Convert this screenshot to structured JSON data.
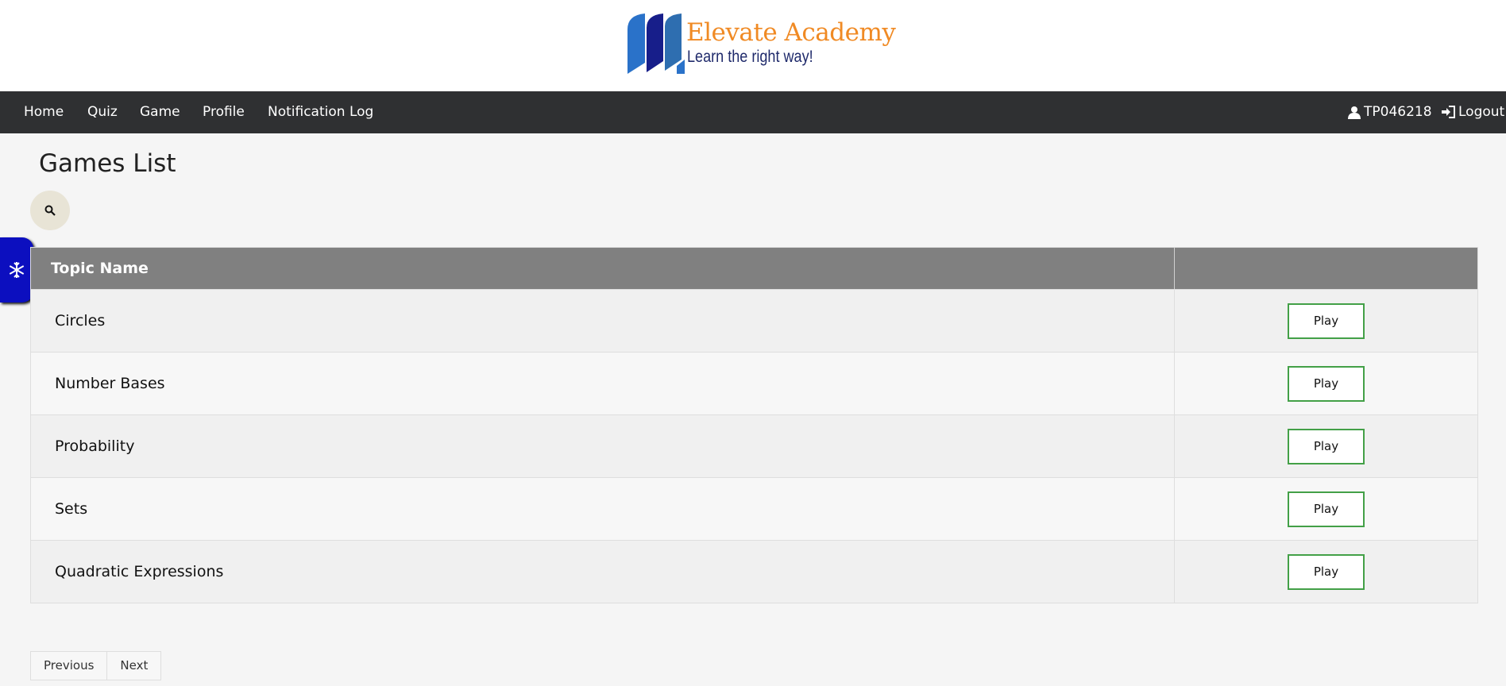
{
  "brand": {
    "name": "Elevate Academy",
    "tagline": "Learn the right way!",
    "name_color": "#f08a24",
    "tagline_color": "#1f2a6b"
  },
  "nav": {
    "items": [
      {
        "label": "Home"
      },
      {
        "label": "Quiz"
      },
      {
        "label": "Game"
      },
      {
        "label": "Profile"
      },
      {
        "label": "Notification Log"
      }
    ],
    "user": {
      "label": "TP046218",
      "icon": "user-icon"
    },
    "logout": {
      "label": "Logout",
      "icon": "sign-in-icon"
    }
  },
  "page": {
    "title": "Games List",
    "search_icon": "search-icon",
    "side_tab_icon": "snowflake-icon"
  },
  "table": {
    "header": {
      "topic": "Topic Name",
      "action": ""
    },
    "rows": [
      {
        "topic": "Circles",
        "action": "Play"
      },
      {
        "topic": "Number Bases",
        "action": "Play"
      },
      {
        "topic": "Probability",
        "action": "Play"
      },
      {
        "topic": "Sets",
        "action": "Play"
      },
      {
        "topic": "Quadratic Expressions",
        "action": "Play"
      }
    ]
  },
  "pagination": {
    "previous": "Previous",
    "next": "Next"
  },
  "colors": {
    "navbar": "#2f3032",
    "table_header": "#808080",
    "play_border": "#43a047",
    "side_tab": "#0c0fbf",
    "search_bg": "#e8e4d6"
  }
}
